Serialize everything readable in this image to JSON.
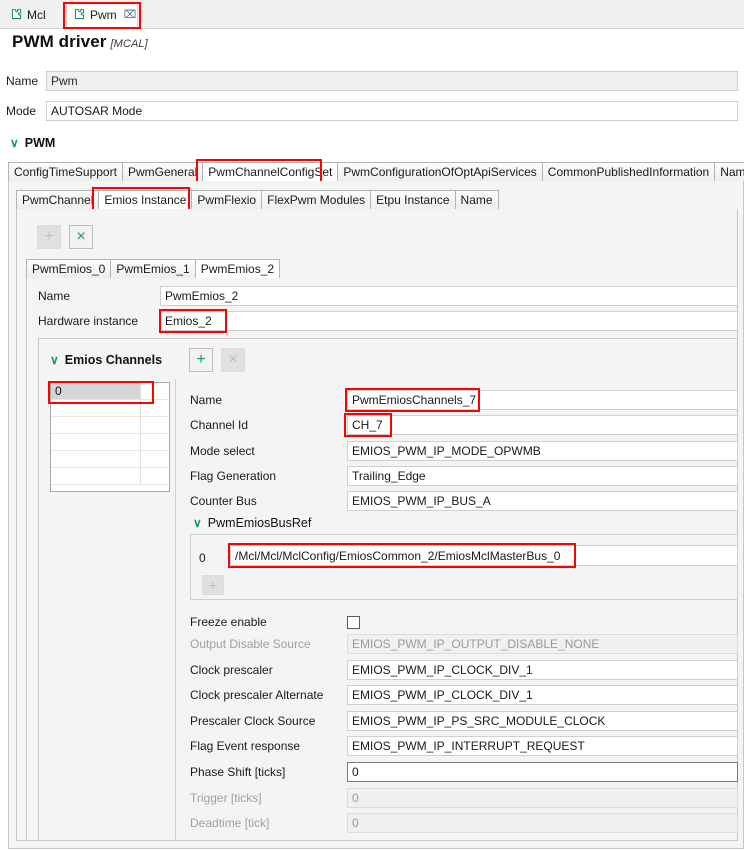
{
  "editor_tabs": [
    {
      "label": "Mcl",
      "icon": "puzzle-icon",
      "active": false,
      "closable": false
    },
    {
      "label": "Pwm",
      "icon": "puzzle-icon",
      "active": true,
      "closable": true,
      "close_glyph": "⌧"
    }
  ],
  "header": {
    "title": "PWM driver",
    "subtitle": "[MCAL]",
    "name_label": "Name",
    "name_value": "Pwm",
    "mode_label": "Mode",
    "mode_value": "AUTOSAR Mode"
  },
  "pwm_section": {
    "label": "PWM",
    "chevron": "∨"
  },
  "outer_tabs": [
    {
      "label": "ConfigTimeSupport",
      "selected": false
    },
    {
      "label": "PwmGeneral",
      "selected": false
    },
    {
      "label": "PwmChannelConfigSet",
      "selected": true
    },
    {
      "label": "PwmConfigurationOfOptApiServices",
      "selected": false
    },
    {
      "label": "CommonPublishedInformation",
      "selected": false
    },
    {
      "label": "Name",
      "selected": false
    }
  ],
  "inner_tabs": [
    {
      "label": "PwmChannel",
      "selected": false
    },
    {
      "label": "Emios Instance",
      "selected": true
    },
    {
      "label": "PwmFlexio",
      "selected": false
    },
    {
      "label": "FlexPwm Modules",
      "selected": false
    },
    {
      "label": "Etpu Instance",
      "selected": false
    },
    {
      "label": "Name",
      "selected": false
    }
  ],
  "instance_toolbar": {
    "add_label": "+",
    "add_enabled": false,
    "delete_label": "×",
    "delete_enabled": true
  },
  "instance_tabs": [
    {
      "label": "PwmEmios_0",
      "selected": false
    },
    {
      "label": "PwmEmios_1",
      "selected": false
    },
    {
      "label": "PwmEmios_2",
      "selected": true
    }
  ],
  "instance_fields": [
    {
      "label": "Name",
      "value": "PwmEmios_2",
      "readonly": false,
      "disabled": false
    },
    {
      "label": "Hardware instance",
      "value": "Emios_2",
      "readonly": false,
      "disabled": false
    }
  ],
  "channels_section": {
    "label": "Emios Channels",
    "chevron": "∨",
    "add_label": "+",
    "add_enabled": true,
    "delete_label": "×",
    "delete_enabled": false,
    "list_items": [
      "0"
    ],
    "selected_index": 0
  },
  "channel_fields": [
    {
      "label": "Name",
      "value": "PwmEmiosChannels_7",
      "disabled": false
    },
    {
      "label": "Channel Id",
      "value": "CH_7",
      "disabled": false
    },
    {
      "label": "Mode select",
      "value": "EMIOS_PWM_IP_MODE_OPWMB",
      "disabled": false
    },
    {
      "label": "Flag Generation",
      "value": "Trailing_Edge",
      "disabled": false
    },
    {
      "label": "Counter Bus",
      "value": "EMIOS_PWM_IP_BUS_A",
      "disabled": false
    }
  ],
  "busref": {
    "label": "PwmEmiosBusRef",
    "chevron": "∨",
    "rows": [
      {
        "index": "0",
        "value": "/Mcl/Mcl/MclConfig/EmiosCommon_2/EmiosMclMasterBus_0"
      }
    ],
    "add_label": "+",
    "add_enabled": false
  },
  "freeze": {
    "label": "Freeze enable",
    "checked": false
  },
  "lower_fields": [
    {
      "label": "Output Disable Source",
      "value": "EMIOS_PWM_IP_OUTPUT_DISABLE_NONE",
      "disabled": true
    },
    {
      "label": "Clock prescaler",
      "value": "EMIOS_PWM_IP_CLOCK_DIV_1",
      "disabled": false
    },
    {
      "label": "Clock prescaler Alternate",
      "value": "EMIOS_PWM_IP_CLOCK_DIV_1",
      "disabled": false
    },
    {
      "label": "Prescaler Clock Source",
      "value": "EMIOS_PWM_IP_PS_SRC_MODULE_CLOCK",
      "disabled": false
    },
    {
      "label": "Flag Event response",
      "value": "EMIOS_PWM_IP_INTERRUPT_REQUEST",
      "disabled": false
    },
    {
      "label": "Phase Shift [ticks]",
      "value": "0",
      "disabled": false
    },
    {
      "label": "Trigger [ticks]",
      "value": "0",
      "disabled": true
    },
    {
      "label": "Deadtime [tick]",
      "value": "0",
      "disabled": true
    }
  ],
  "colors": {
    "accent": "#1d8f73",
    "highlight": "#ff0000",
    "panel_bg": "#f4f4f4",
    "field_bg": "#ffffff",
    "disabled_bg": "#f0f0f0"
  }
}
